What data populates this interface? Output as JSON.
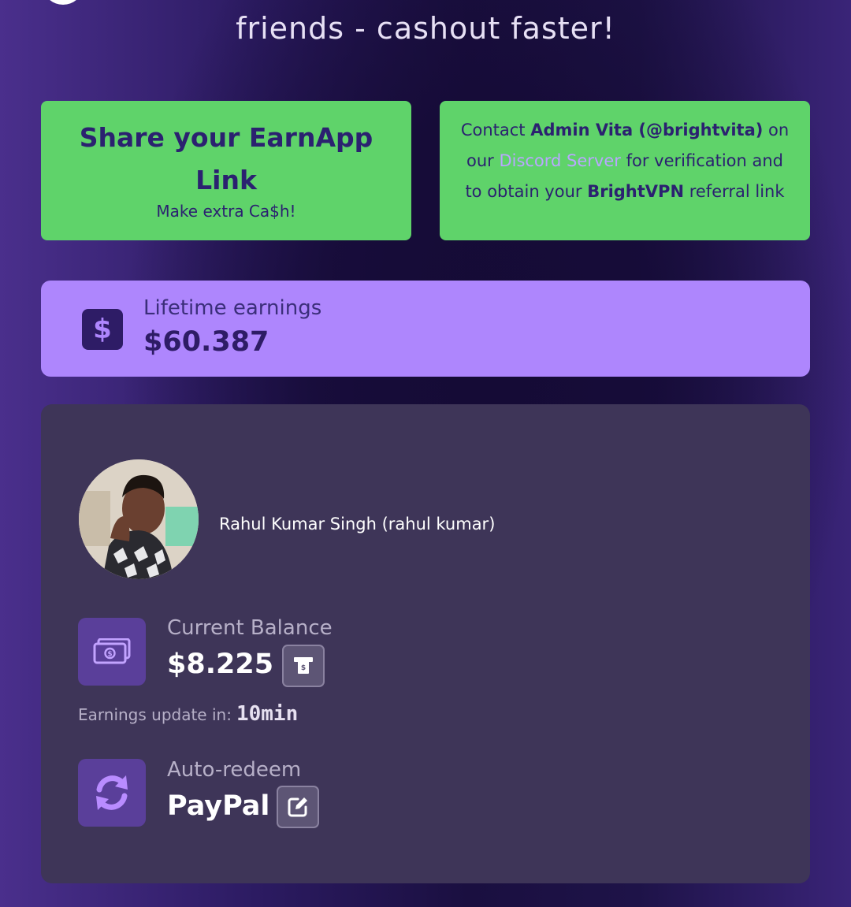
{
  "hero": {
    "line": "friends - cashout faster!"
  },
  "share_card": {
    "title_line1": "Share your EarnApp",
    "title_line2": "Link",
    "subtitle": "Make extra Ca$h!"
  },
  "contact_card": {
    "t1": "Contact ",
    "admin": "Admin Vita (@brightvita)",
    "t2": " on",
    "t3": "our ",
    "discord": "Discord Server",
    "t4": " for verification and",
    "t5": "to obtain your ",
    "vpn": "BrightVPN",
    "t6": " referral link"
  },
  "lifetime": {
    "icon": "dollar-icon",
    "label": "Lifetime earnings",
    "value": "$60.387"
  },
  "profile": {
    "name": "Rahul Kumar Singh (rahul kumar)",
    "balance_label": "Current Balance",
    "balance_value": "$8.225",
    "update_label": "Earnings update in:",
    "update_time": "10min",
    "redeem_label": "Auto-redeem",
    "redeem_value": "PayPal"
  },
  "colors": {
    "green": "#5fd36a",
    "purple_card": "#ae86fd",
    "dark_card": "#3e3558",
    "accent_icon": "#b98cff"
  }
}
